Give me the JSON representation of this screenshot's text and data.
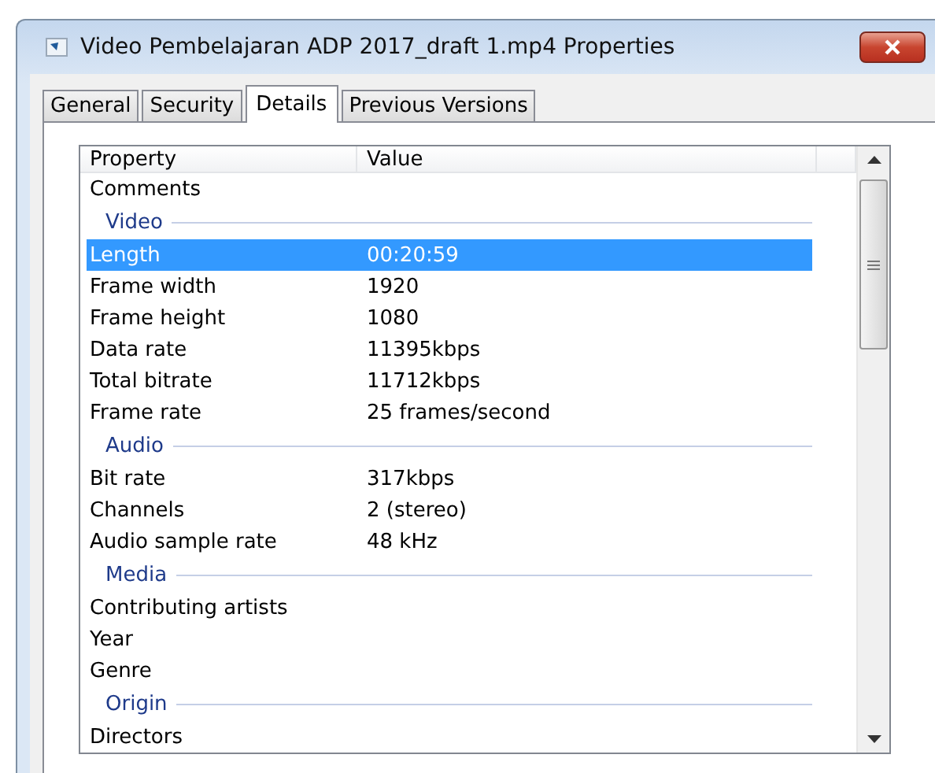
{
  "window": {
    "title": "Video Pembelajaran ADP 2017_draft 1.mp4 Properties"
  },
  "tabs": [
    {
      "label": "General",
      "selected": false
    },
    {
      "label": "Security",
      "selected": false
    },
    {
      "label": "Details",
      "selected": true
    },
    {
      "label": "Previous Versions",
      "selected": false
    }
  ],
  "table": {
    "columns": [
      "Property",
      "Value"
    ],
    "rows": [
      {
        "kind": "item",
        "property": "Comments",
        "selected": false
      },
      {
        "kind": "group",
        "property": "Video"
      },
      {
        "kind": "item",
        "property": "Length",
        "value": "00:20:59",
        "selected": true
      },
      {
        "kind": "item",
        "property": "Frame width",
        "value": "1920",
        "selected": false
      },
      {
        "kind": "item",
        "property": "Frame height",
        "value": "1080",
        "selected": false
      },
      {
        "kind": "item",
        "property": "Data rate",
        "value": "11395kbps",
        "selected": false
      },
      {
        "kind": "item",
        "property": "Total bitrate",
        "value": "11712kbps",
        "selected": false
      },
      {
        "kind": "item",
        "property": "Frame rate",
        "value": "25 frames/second",
        "selected": false
      },
      {
        "kind": "group",
        "property": "Audio"
      },
      {
        "kind": "item",
        "property": "Bit rate",
        "value": "317kbps",
        "selected": false
      },
      {
        "kind": "item",
        "property": "Channels",
        "value": "2 (stereo)",
        "selected": false
      },
      {
        "kind": "item",
        "property": "Audio sample rate",
        "value": "48 kHz",
        "selected": false
      },
      {
        "kind": "group",
        "property": "Media"
      },
      {
        "kind": "item",
        "property": "Contributing artists",
        "selected": false
      },
      {
        "kind": "item",
        "property": "Year",
        "selected": false
      },
      {
        "kind": "item",
        "property": "Genre",
        "selected": false
      },
      {
        "kind": "group",
        "property": "Origin"
      },
      {
        "kind": "item",
        "property": "Directors",
        "selected": false
      }
    ]
  }
}
